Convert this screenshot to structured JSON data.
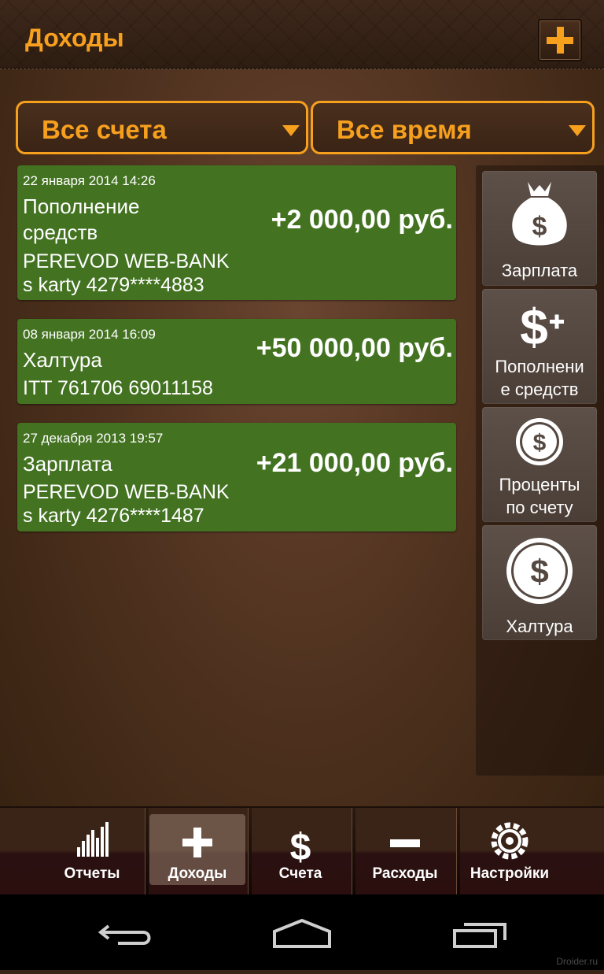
{
  "header": {
    "title": "Доходы"
  },
  "filters": {
    "account": "Все счета",
    "period": "Все время"
  },
  "transactions": [
    {
      "date": "22 января 2014 14:26",
      "name_line1": "Пополнение",
      "name_line2": "средств",
      "desc_line1": "PEREVOD WEB-BANK",
      "desc_line2": "s karty 4279****4883",
      "amount": "+2 000,00 руб."
    },
    {
      "date": "08 января 2014 16:09",
      "name_line1": "Халтура",
      "desc_line1": "ITT 761706 69011158",
      "amount": "+50 000,00 руб."
    },
    {
      "date": "27 декабря 2013 19:57",
      "name_line1": "Зарплата",
      "desc_line1": "PEREVOD WEB-BANK",
      "desc_line2": "s karty 4276****1487",
      "amount": "+21 000,00 руб."
    }
  ],
  "categories": [
    {
      "label_line1": "Зарплата",
      "icon": "money-bag-icon"
    },
    {
      "label_line1": "Пополнени",
      "label_line2": "е средств",
      "icon": "dollar-plus-icon"
    },
    {
      "label_line1": "Проценты",
      "label_line2": "по счету",
      "icon": "dollar-coin-icon"
    },
    {
      "label_line1": "Халтура",
      "icon": "dollar-coin-large-icon"
    }
  ],
  "nav": {
    "reports": "Отчеты",
    "income": "Доходы",
    "accounts": "Счета",
    "expenses": "Расходы",
    "settings": "Настройки"
  },
  "watermark": "Droider.ru",
  "colors": {
    "accent": "#f7a01e",
    "card_green": "#437221",
    "category_tile": "#554841"
  }
}
